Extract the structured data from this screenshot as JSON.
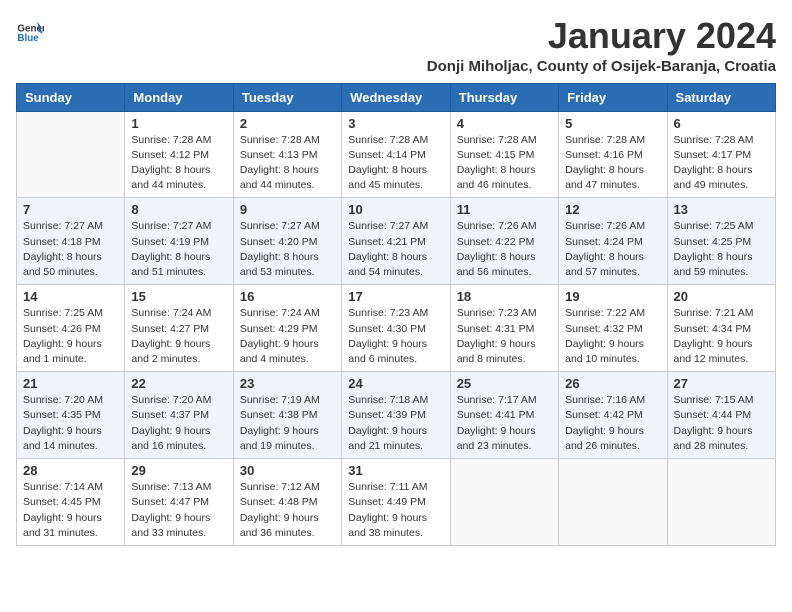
{
  "header": {
    "logo_general": "General",
    "logo_blue": "Blue",
    "month_title": "January 2024",
    "location": "Donji Miholjac, County of Osijek-Baranja, Croatia"
  },
  "weekdays": [
    "Sunday",
    "Monday",
    "Tuesday",
    "Wednesday",
    "Thursday",
    "Friday",
    "Saturday"
  ],
  "weeks": [
    [
      {
        "day": "",
        "sunrise": "",
        "sunset": "",
        "daylight": ""
      },
      {
        "day": "1",
        "sunrise": "Sunrise: 7:28 AM",
        "sunset": "Sunset: 4:12 PM",
        "daylight": "Daylight: 8 hours and 44 minutes."
      },
      {
        "day": "2",
        "sunrise": "Sunrise: 7:28 AM",
        "sunset": "Sunset: 4:13 PM",
        "daylight": "Daylight: 8 hours and 44 minutes."
      },
      {
        "day": "3",
        "sunrise": "Sunrise: 7:28 AM",
        "sunset": "Sunset: 4:14 PM",
        "daylight": "Daylight: 8 hours and 45 minutes."
      },
      {
        "day": "4",
        "sunrise": "Sunrise: 7:28 AM",
        "sunset": "Sunset: 4:15 PM",
        "daylight": "Daylight: 8 hours and 46 minutes."
      },
      {
        "day": "5",
        "sunrise": "Sunrise: 7:28 AM",
        "sunset": "Sunset: 4:16 PM",
        "daylight": "Daylight: 8 hours and 47 minutes."
      },
      {
        "day": "6",
        "sunrise": "Sunrise: 7:28 AM",
        "sunset": "Sunset: 4:17 PM",
        "daylight": "Daylight: 8 hours and 49 minutes."
      }
    ],
    [
      {
        "day": "7",
        "sunrise": "Sunrise: 7:27 AM",
        "sunset": "Sunset: 4:18 PM",
        "daylight": "Daylight: 8 hours and 50 minutes."
      },
      {
        "day": "8",
        "sunrise": "Sunrise: 7:27 AM",
        "sunset": "Sunset: 4:19 PM",
        "daylight": "Daylight: 8 hours and 51 minutes."
      },
      {
        "day": "9",
        "sunrise": "Sunrise: 7:27 AM",
        "sunset": "Sunset: 4:20 PM",
        "daylight": "Daylight: 8 hours and 53 minutes."
      },
      {
        "day": "10",
        "sunrise": "Sunrise: 7:27 AM",
        "sunset": "Sunset: 4:21 PM",
        "daylight": "Daylight: 8 hours and 54 minutes."
      },
      {
        "day": "11",
        "sunrise": "Sunrise: 7:26 AM",
        "sunset": "Sunset: 4:22 PM",
        "daylight": "Daylight: 8 hours and 56 minutes."
      },
      {
        "day": "12",
        "sunrise": "Sunrise: 7:26 AM",
        "sunset": "Sunset: 4:24 PM",
        "daylight": "Daylight: 8 hours and 57 minutes."
      },
      {
        "day": "13",
        "sunrise": "Sunrise: 7:25 AM",
        "sunset": "Sunset: 4:25 PM",
        "daylight": "Daylight: 8 hours and 59 minutes."
      }
    ],
    [
      {
        "day": "14",
        "sunrise": "Sunrise: 7:25 AM",
        "sunset": "Sunset: 4:26 PM",
        "daylight": "Daylight: 9 hours and 1 minute."
      },
      {
        "day": "15",
        "sunrise": "Sunrise: 7:24 AM",
        "sunset": "Sunset: 4:27 PM",
        "daylight": "Daylight: 9 hours and 2 minutes."
      },
      {
        "day": "16",
        "sunrise": "Sunrise: 7:24 AM",
        "sunset": "Sunset: 4:29 PM",
        "daylight": "Daylight: 9 hours and 4 minutes."
      },
      {
        "day": "17",
        "sunrise": "Sunrise: 7:23 AM",
        "sunset": "Sunset: 4:30 PM",
        "daylight": "Daylight: 9 hours and 6 minutes."
      },
      {
        "day": "18",
        "sunrise": "Sunrise: 7:23 AM",
        "sunset": "Sunset: 4:31 PM",
        "daylight": "Daylight: 9 hours and 8 minutes."
      },
      {
        "day": "19",
        "sunrise": "Sunrise: 7:22 AM",
        "sunset": "Sunset: 4:32 PM",
        "daylight": "Daylight: 9 hours and 10 minutes."
      },
      {
        "day": "20",
        "sunrise": "Sunrise: 7:21 AM",
        "sunset": "Sunset: 4:34 PM",
        "daylight": "Daylight: 9 hours and 12 minutes."
      }
    ],
    [
      {
        "day": "21",
        "sunrise": "Sunrise: 7:20 AM",
        "sunset": "Sunset: 4:35 PM",
        "daylight": "Daylight: 9 hours and 14 minutes."
      },
      {
        "day": "22",
        "sunrise": "Sunrise: 7:20 AM",
        "sunset": "Sunset: 4:37 PM",
        "daylight": "Daylight: 9 hours and 16 minutes."
      },
      {
        "day": "23",
        "sunrise": "Sunrise: 7:19 AM",
        "sunset": "Sunset: 4:38 PM",
        "daylight": "Daylight: 9 hours and 19 minutes."
      },
      {
        "day": "24",
        "sunrise": "Sunrise: 7:18 AM",
        "sunset": "Sunset: 4:39 PM",
        "daylight": "Daylight: 9 hours and 21 minutes."
      },
      {
        "day": "25",
        "sunrise": "Sunrise: 7:17 AM",
        "sunset": "Sunset: 4:41 PM",
        "daylight": "Daylight: 9 hours and 23 minutes."
      },
      {
        "day": "26",
        "sunrise": "Sunrise: 7:16 AM",
        "sunset": "Sunset: 4:42 PM",
        "daylight": "Daylight: 9 hours and 26 minutes."
      },
      {
        "day": "27",
        "sunrise": "Sunrise: 7:15 AM",
        "sunset": "Sunset: 4:44 PM",
        "daylight": "Daylight: 9 hours and 28 minutes."
      }
    ],
    [
      {
        "day": "28",
        "sunrise": "Sunrise: 7:14 AM",
        "sunset": "Sunset: 4:45 PM",
        "daylight": "Daylight: 9 hours and 31 minutes."
      },
      {
        "day": "29",
        "sunrise": "Sunrise: 7:13 AM",
        "sunset": "Sunset: 4:47 PM",
        "daylight": "Daylight: 9 hours and 33 minutes."
      },
      {
        "day": "30",
        "sunrise": "Sunrise: 7:12 AM",
        "sunset": "Sunset: 4:48 PM",
        "daylight": "Daylight: 9 hours and 36 minutes."
      },
      {
        "day": "31",
        "sunrise": "Sunrise: 7:11 AM",
        "sunset": "Sunset: 4:49 PM",
        "daylight": "Daylight: 9 hours and 38 minutes."
      },
      {
        "day": "",
        "sunrise": "",
        "sunset": "",
        "daylight": ""
      },
      {
        "day": "",
        "sunrise": "",
        "sunset": "",
        "daylight": ""
      },
      {
        "day": "",
        "sunrise": "",
        "sunset": "",
        "daylight": ""
      }
    ]
  ]
}
